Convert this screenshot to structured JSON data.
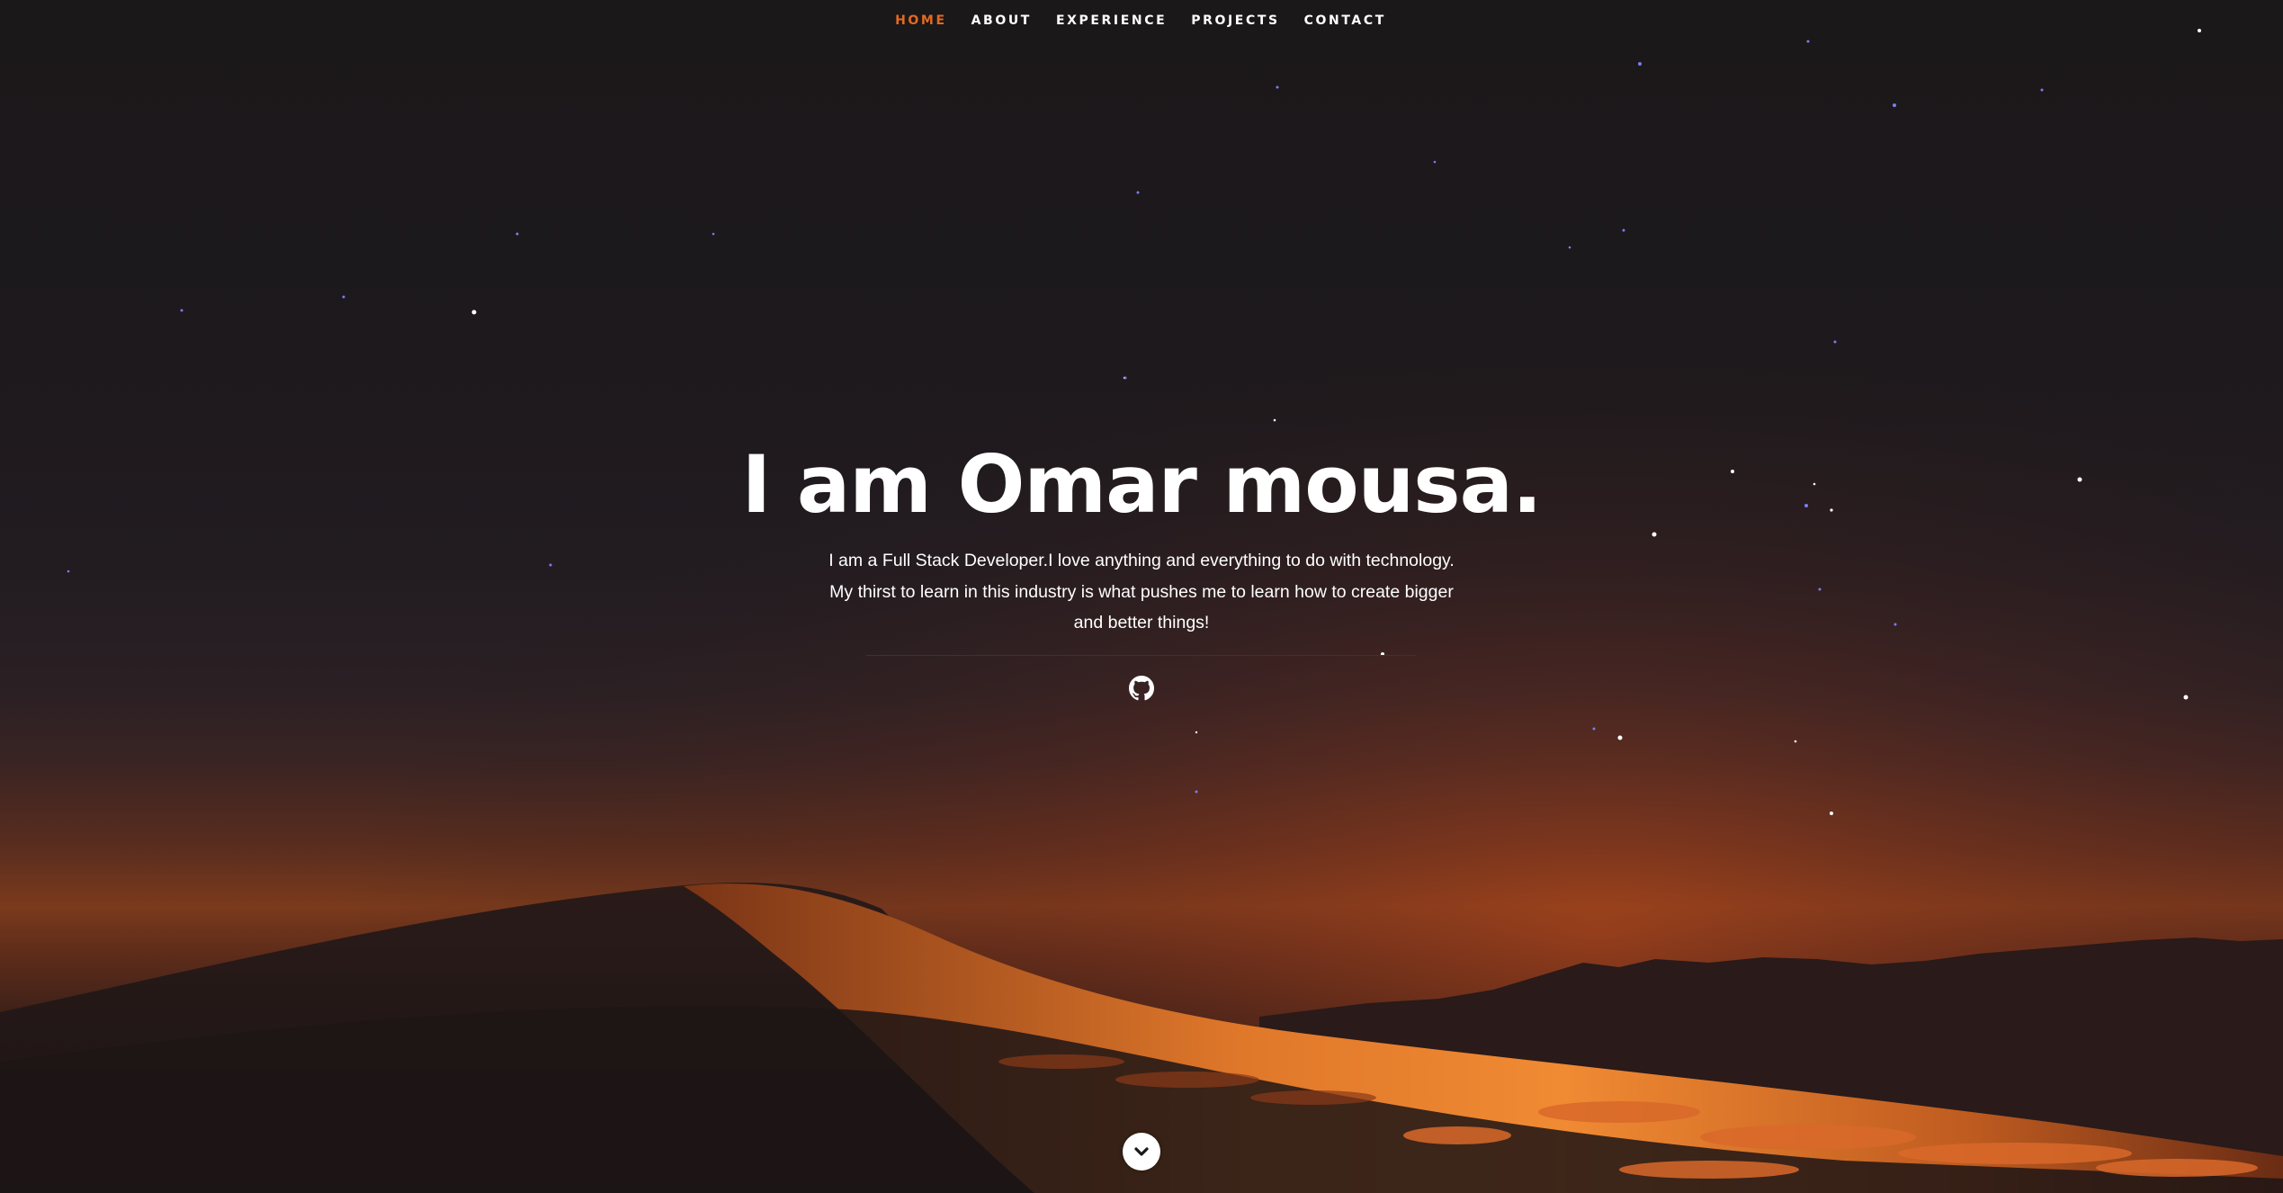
{
  "nav": {
    "items": [
      {
        "label": "HOME",
        "active": true
      },
      {
        "label": "ABOUT",
        "active": false
      },
      {
        "label": "EXPERIENCE",
        "active": false
      },
      {
        "label": "PROJECTS",
        "active": false
      },
      {
        "label": "CONTACT",
        "active": false
      }
    ]
  },
  "hero": {
    "title": "I am Omar mousa.",
    "description": "I am a Full Stack Developer.I love anything and everything to do with technology. My thirst to learn in this industry is what pushes me to learn how to create bigger and better things!"
  },
  "social": {
    "icon": "github-icon"
  },
  "scroll": {
    "icon": "chevron-down-icon"
  },
  "colors": {
    "accent": "#e06a23",
    "text": "#ffffff",
    "background": "#1b181a"
  }
}
